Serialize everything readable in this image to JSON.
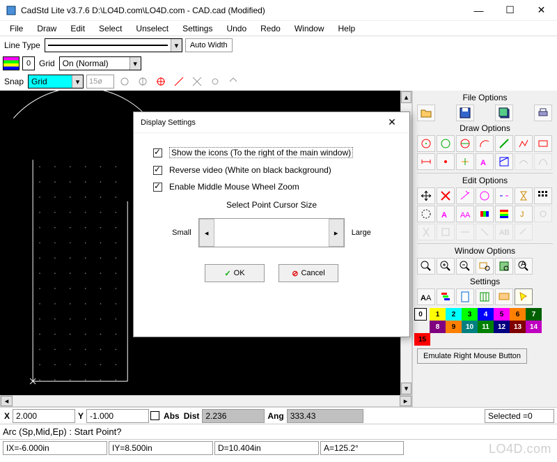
{
  "window": {
    "title": "CadStd Lite v3.7.6    D:\\LO4D.com\\LO4D.com - CAD.cad  (Modified)"
  },
  "menu": [
    "File",
    "Draw",
    "Edit",
    "Select",
    "Unselect",
    "Settings",
    "Undo",
    "Redo",
    "Window",
    "Help"
  ],
  "toolbar": {
    "line_type_label": "Line Type",
    "auto_width": "Auto Width",
    "grid_label": "Grid",
    "grid_value": "On (Normal)",
    "layer_num": "0",
    "snap_label": "Snap",
    "snap_value": "Grid",
    "snap_size": "15ø"
  },
  "panel": {
    "file_options": "File Options",
    "draw_options": "Draw Options",
    "edit_options": "Edit Options",
    "window_options": "Window Options",
    "settings": "Settings",
    "emulate": "Emulate Right Mouse Button"
  },
  "palette": {
    "labels": [
      "0",
      "1",
      "2",
      "3",
      "4",
      "5",
      "6",
      "7",
      "8",
      "9",
      "10",
      "11",
      "12",
      "13",
      "14",
      "15"
    ],
    "colors": [
      "#ffffff",
      "#ffff00",
      "#00ffff",
      "#00ff00",
      "#0000ff",
      "#ff00ff",
      "#ff8000",
      "#006000",
      "#800080",
      "#808000",
      "#008080",
      "#008000",
      "#000080",
      "#800000",
      "#c000c0",
      "#ff0000"
    ]
  },
  "dialog": {
    "title": "Display Settings",
    "opt1": "Show the icons (To the right of the main window)",
    "opt2": "Reverse video (White on black background)",
    "opt3": "Enable Middle Mouse Wheel Zoom",
    "slider_label": "Select Point Cursor Size",
    "small": "Small",
    "large": "Large",
    "ok": "OK",
    "cancel": "Cancel"
  },
  "status": {
    "x_label": "X",
    "x_val": "2.000",
    "y_label": "Y",
    "y_val": "-1.000",
    "abs_label": "Abs",
    "dist_label": "Dist",
    "dist_val": "2.236",
    "ang_label": "Ang",
    "ang_val": "333.43",
    "prompt": "Arc (Sp,Mid,Ep) : Start Point?",
    "ix": "IX=-6.000in",
    "iy": "IY=8.500in",
    "d": "D=10.404in",
    "a": "A=125.2°",
    "selected": "Selected =0"
  },
  "watermark": "LO4D.com"
}
